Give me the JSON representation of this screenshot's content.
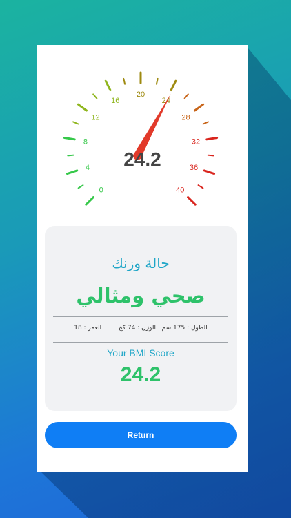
{
  "gauge": {
    "value": 24.2,
    "value_label": "24.2",
    "min": 0,
    "max": 40,
    "labels": [
      "0",
      "4",
      "8",
      "12",
      "16",
      "20",
      "24",
      "28",
      "32",
      "36",
      "40"
    ],
    "colors": {
      "green": "#36c84a",
      "yellow_green": "#8fb61e",
      "olive": "#9e8a10",
      "orange": "#c8651a",
      "red": "#d9251e",
      "needle": "#e23a2a"
    }
  },
  "result": {
    "status_heading": "حالة وزنك",
    "status_value": "صحي ومثالي",
    "height": "الطول : 175 سم",
    "weight": "الوزن : 74 كج",
    "separator": "|",
    "age": "العمر : 18",
    "score_label": "Your BMI Score",
    "score_value": "24.2"
  },
  "actions": {
    "return_label": "Return"
  }
}
